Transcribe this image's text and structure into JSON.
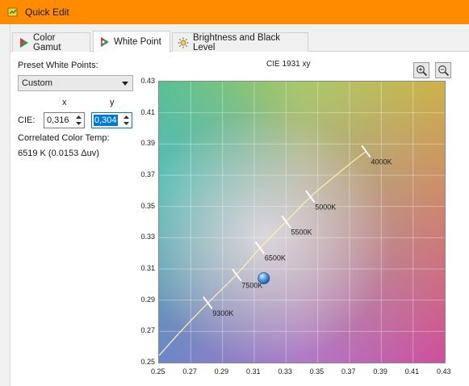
{
  "window": {
    "title": "Quick Edit",
    "app_icon": "quick-edit-app-icon"
  },
  "tabs": [
    {
      "label": "Color Gamut",
      "icon": "color-gamut-icon",
      "active": false
    },
    {
      "label": "White Point",
      "icon": "white-point-icon",
      "active": true
    },
    {
      "label": "Brightness and Black Level",
      "icon": "sun-icon",
      "active": false
    }
  ],
  "white_point": {
    "preset_label": "Preset White Points:",
    "preset_value": "Custom",
    "x_header": "x",
    "y_header": "y",
    "cie_label": "CIE:",
    "x_value": "0,316",
    "y_value": "0,304",
    "cct_label": "Correlated Color Temp:",
    "cct_value": "6519 K (0.0153 Δuv)"
  },
  "zoom": {
    "zoom_in_icon": "zoom-in-icon",
    "zoom_out_icon": "zoom-out-icon"
  },
  "chart_data": {
    "type": "scatter",
    "title": "CIE 1931 xy",
    "xlim": [
      0.25,
      0.43
    ],
    "ylim": [
      0.25,
      0.43
    ],
    "x_ticks": [
      "0.25",
      "0.27",
      "0.29",
      "0.31",
      "0.33",
      "0.35",
      "0.37",
      "0.39",
      "0.41",
      "0.43"
    ],
    "y_ticks": [
      "0.43",
      "0.41",
      "0.39",
      "0.37",
      "0.35",
      "0.33",
      "0.31",
      "0.29",
      "0.27",
      "0.25"
    ],
    "grid": true,
    "planckian_locus": [
      [
        0.25,
        0.2545
      ],
      [
        0.264,
        0.2705
      ],
      [
        0.2807,
        0.2883
      ],
      [
        0.299,
        0.3061
      ],
      [
        0.3135,
        0.3236
      ],
      [
        0.3301,
        0.3402
      ],
      [
        0.3452,
        0.3564
      ],
      [
        0.3606,
        0.3693
      ],
      [
        0.3718,
        0.3787
      ],
      [
        0.3804,
        0.3853
      ]
    ],
    "cct_markers": [
      {
        "label": "9300K",
        "x": 0.2807,
        "y": 0.2883
      },
      {
        "label": "7500K",
        "x": 0.299,
        "y": 0.3061
      },
      {
        "label": "6500K",
        "x": 0.3135,
        "y": 0.3236
      },
      {
        "label": "5500K",
        "x": 0.3301,
        "y": 0.3402
      },
      {
        "label": "5000K",
        "x": 0.3452,
        "y": 0.3564
      },
      {
        "label": "4000K",
        "x": 0.3804,
        "y": 0.3853
      }
    ],
    "current_point": {
      "x": 0.316,
      "y": 0.304
    },
    "colors": {
      "locus": "#fff3b0",
      "marker": "#ffffff",
      "point": "#2f7fd6"
    }
  }
}
